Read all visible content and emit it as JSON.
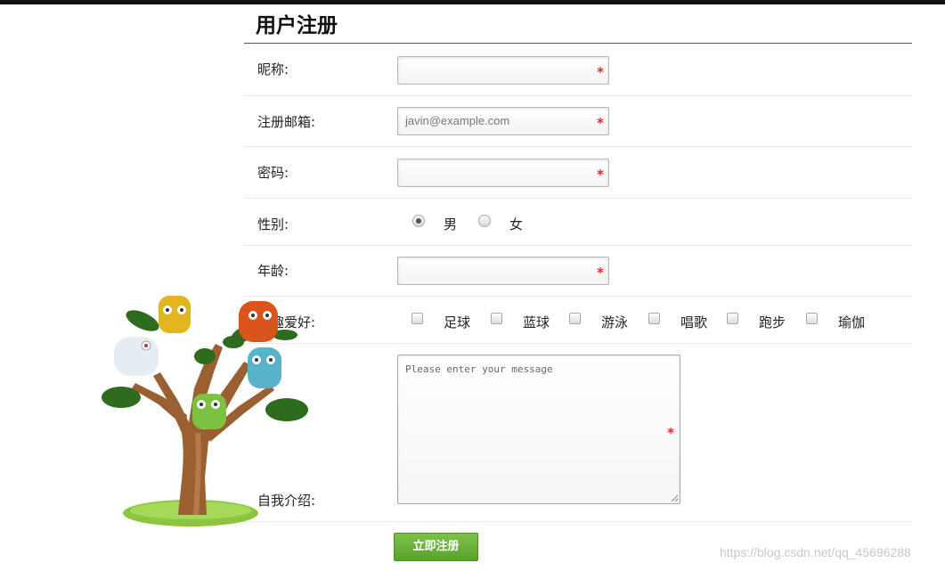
{
  "form": {
    "title": "用户注册",
    "nickname": {
      "label": "昵称:",
      "value": "",
      "required_mark": "*"
    },
    "email": {
      "label": "注册邮箱:",
      "placeholder": "javin@example.com",
      "required_mark": "*"
    },
    "password": {
      "label": "密码:",
      "value": "",
      "required_mark": "*"
    },
    "gender": {
      "label": "性别:",
      "options": [
        {
          "label": "男",
          "checked": true
        },
        {
          "label": "女",
          "checked": false
        }
      ]
    },
    "age": {
      "label": "年龄:",
      "value": "",
      "required_mark": "*"
    },
    "hobbies": {
      "label": "兴趣爱好:",
      "options": [
        {
          "label": "足球"
        },
        {
          "label": "蓝球"
        },
        {
          "label": "游泳"
        },
        {
          "label": "唱歌"
        },
        {
          "label": "跑步"
        },
        {
          "label": "瑜伽"
        }
      ]
    },
    "intro": {
      "label": "自我介绍:",
      "placeholder": "Please enter your message",
      "required_mark": "*"
    },
    "submit_label": "立即注册"
  },
  "watermark": "https://blog.csdn.net/qq_45696288",
  "colors": {
    "accent_green": "#66b032",
    "required_red": "#e0282e"
  }
}
